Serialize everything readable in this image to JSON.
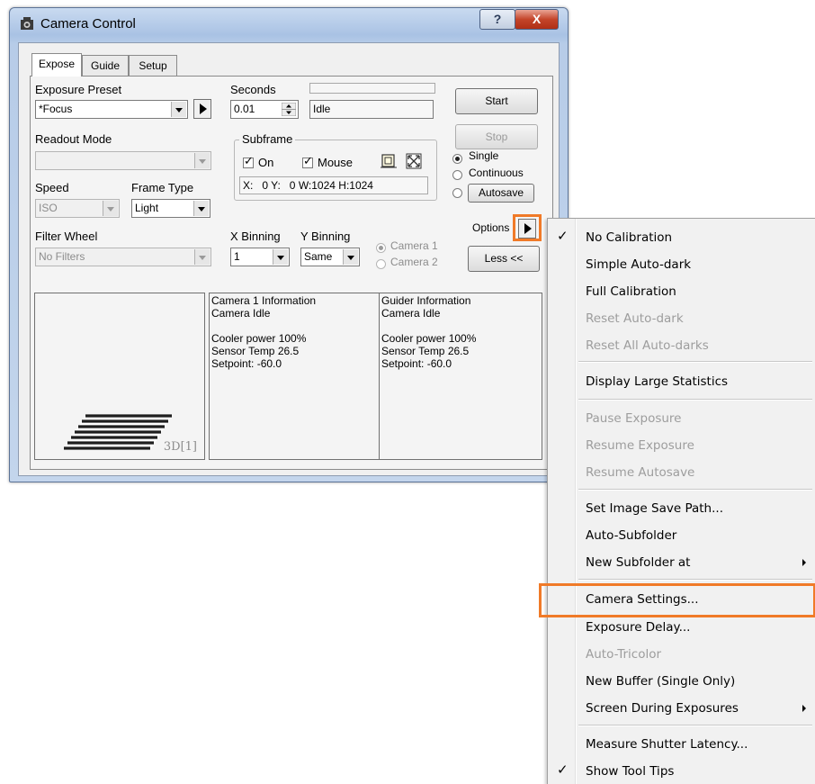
{
  "window": {
    "title": "Camera Control",
    "help_label": "?",
    "close_label": "X"
  },
  "tabs": [
    "Expose",
    "Guide",
    "Setup"
  ],
  "expose": {
    "exposure_preset_label": "Exposure Preset",
    "exposure_preset_value": "*Focus",
    "seconds_label": "Seconds",
    "seconds_value": "0.01",
    "status_value": "Idle",
    "readout_mode_label": "Readout Mode",
    "readout_mode_value": "",
    "speed_label": "Speed",
    "speed_value": "ISO",
    "frame_type_label": "Frame Type",
    "frame_type_value": "Light",
    "filter_wheel_label": "Filter Wheel",
    "filter_wheel_value": "No Filters",
    "subframe": {
      "label": "Subframe",
      "on_label": "On",
      "mouse_label": "Mouse",
      "coords": "X:   0 Y:   0 W:1024 H:1024"
    },
    "x_binning_label": "X Binning",
    "x_binning_value": "1",
    "y_binning_label": "Y Binning",
    "y_binning_value": "Same",
    "camera1_label": "Camera 1",
    "camera2_label": "Camera 2",
    "start_label": "Start",
    "stop_label": "Stop",
    "single_label": "Single",
    "continuous_label": "Continuous",
    "autosave_label": "Autosave",
    "options_label": "Options",
    "less_label": "Less <<"
  },
  "preview": {
    "label": "3D[1]"
  },
  "camera1_info": "Camera 1 Information\nCamera Idle\n\nCooler power 100%\nSensor Temp 26.5\nSetpoint: -60.0",
  "guider_info": "Guider Information\nCamera Idle\n\nCooler power 100%\nSensor Temp 26.5\nSetpoint: -60.0",
  "menu": {
    "items": [
      "No Calibration",
      "Simple Auto-dark",
      "Full Calibration",
      "Reset Auto-dark",
      "Reset All Auto-darks",
      "Display Large Statistics",
      "Pause Exposure",
      "Resume Exposure",
      "Resume Autosave",
      "Set Image Save Path...",
      "Auto-Subfolder",
      "New Subfolder at",
      "Camera Settings...",
      "Exposure Delay...",
      "Auto-Tricolor",
      "New Buffer (Single Only)",
      "Screen During Exposures",
      "Measure Shutter Latency...",
      "Show Tool Tips"
    ],
    "check_mark": "✓"
  },
  "colors": {
    "highlight": "#f07a28",
    "title_bar": "#b7cce8",
    "close_button": "#c4452a"
  }
}
